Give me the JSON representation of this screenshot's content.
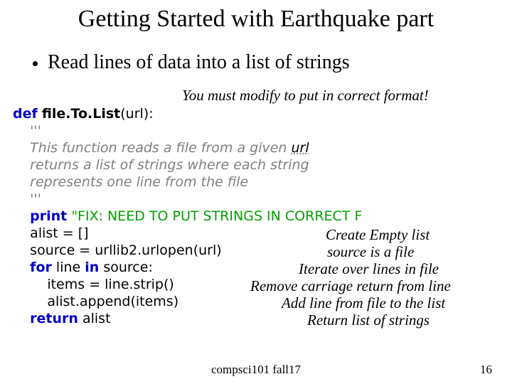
{
  "title": "Getting Started with Earthquake part",
  "bullet": "Read lines of data into a list of strings",
  "note_modify": "You must modify to put in correct format!",
  "code": {
    "l1_def": "def",
    "l1_fn": "file.To.List",
    "l1_arg": "(url)",
    "l2": "'''",
    "l3a": "This function reads a file from a given ",
    "l3b": "url",
    "l4": "returns a list of strings where each string",
    "l5": "represents one line from the file",
    "l6": "'''",
    "l7_kw": "print",
    "l7_str": "\"FIX: NEED TO PUT STRINGS IN CORRECT F",
    "l8": "alist = []",
    "l9": "source = urllib2.urlopen(url)",
    "l10_kw": "for",
    "l10_a": "line ",
    "l10_in": "in",
    "l10_b": " source:",
    "l11": "items = line.strip()",
    "l12": "alist.append(items)",
    "l13_kw": "return",
    "l13_b": " alist"
  },
  "annotations": {
    "a1": "Create Empty list",
    "a2": "source is a file",
    "a3": "Iterate over lines in file",
    "a4": "Remove carriage return from line",
    "a5": "Add line from file to the list",
    "a6": "Return list of strings"
  },
  "footer_center": "compsci101 fall17",
  "footer_right": "16"
}
